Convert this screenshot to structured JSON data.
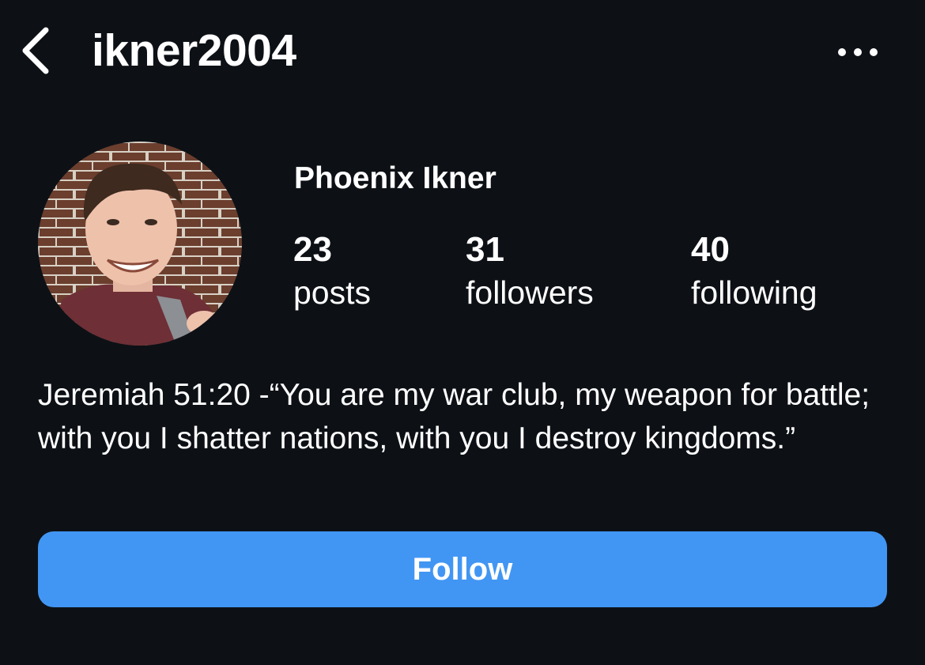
{
  "header": {
    "back_icon": "chevron-left-icon",
    "username": "ikner2004",
    "more_icon": "more-horizontal-icon"
  },
  "profile": {
    "avatar_icon": "profile-photo",
    "display_name": "Phoenix Ikner",
    "stats": [
      {
        "count": "23",
        "label": "posts"
      },
      {
        "count": "31",
        "label": "followers"
      },
      {
        "count": "40",
        "label": "following"
      }
    ],
    "bio": "Jeremiah 51:20 -“You are my war club, my weapon for battle; with you I shatter nations, with you I destroy kingdoms.”"
  },
  "actions": {
    "follow_label": "Follow"
  },
  "colors": {
    "background": "#0d1116",
    "text": "#ffffff",
    "follow_button": "#4196f3"
  }
}
